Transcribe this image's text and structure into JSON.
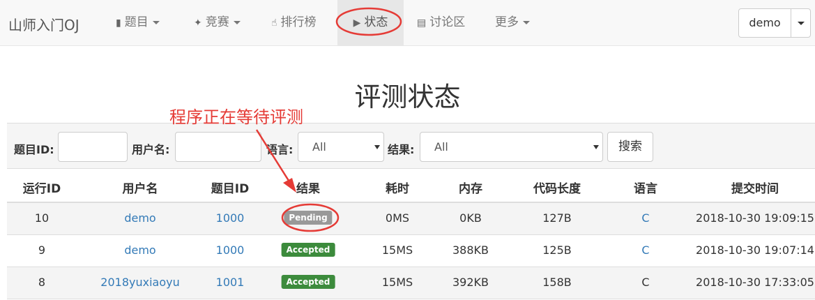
{
  "navbar": {
    "brand": "山师入门OJ",
    "items": [
      {
        "label": "题目",
        "icon": "book-icon",
        "dropdown": true
      },
      {
        "label": "竞赛",
        "icon": "fire-icon",
        "dropdown": true
      },
      {
        "label": "排行榜",
        "icon": "thumbs-up-icon",
        "dropdown": false
      },
      {
        "label": "状态",
        "icon": "play-circle-icon",
        "dropdown": false,
        "active": true
      },
      {
        "label": "讨论区",
        "icon": "list-alt-icon",
        "dropdown": false
      },
      {
        "label": "更多",
        "icon": "",
        "dropdown": true
      }
    ],
    "user": "demo"
  },
  "page": {
    "title": "评测状态"
  },
  "annotation": {
    "text": "程序正在等待评测",
    "color": "#e53b36"
  },
  "filter": {
    "problem_id_label": "题目ID:",
    "problem_id_value": "",
    "username_label": "用户名:",
    "username_value": "",
    "language_label": "语言:",
    "language_value": "All",
    "result_label": "结果:",
    "result_value": "All",
    "search_label": "搜索"
  },
  "table": {
    "headers": [
      "运行ID",
      "用户名",
      "题目ID",
      "结果",
      "耗时",
      "内存",
      "代码长度",
      "语言",
      "提交时间"
    ],
    "rows": [
      {
        "run_id": "10",
        "user": "demo",
        "problem_id": "1000",
        "result": "Pending",
        "time": "0MS",
        "memory": "0KB",
        "code_length": "127B",
        "language": "C",
        "submit_time": "2018-10-30 19:09:15"
      },
      {
        "run_id": "9",
        "user": "demo",
        "problem_id": "1000",
        "result": "Accepted",
        "time": "15MS",
        "memory": "388KB",
        "code_length": "125B",
        "language": "C",
        "submit_time": "2018-10-30 19:07:14"
      },
      {
        "run_id": "8",
        "user": "2018yuxiaoyu",
        "problem_id": "1001",
        "result": "Accepted",
        "time": "15MS",
        "memory": "392KB",
        "code_length": "158B",
        "language": "C",
        "submit_time": "2018-10-30 17:33:05"
      }
    ]
  },
  "colors": {
    "link": "#337ab7",
    "pending": "#999999",
    "accepted": "#3c8b3c",
    "annotation_red": "#e53b36"
  }
}
